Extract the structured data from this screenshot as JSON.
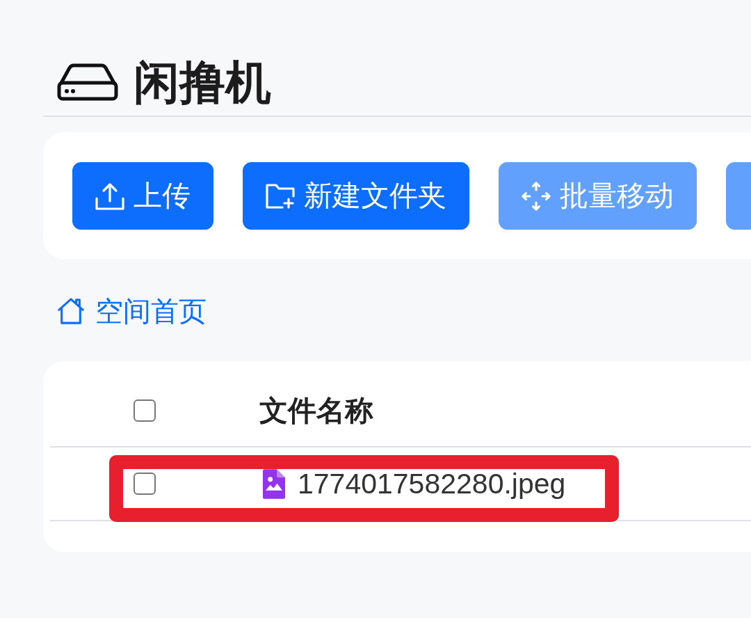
{
  "title": {
    "text": "闲撸机"
  },
  "toolbar": {
    "buttons": [
      {
        "kind": "upload",
        "label": "上传",
        "disabled": false
      },
      {
        "kind": "new_folder",
        "label": "新建文件夹",
        "disabled": false
      },
      {
        "kind": "batch_move",
        "label": "批量移动",
        "disabled": true
      },
      {
        "disabled": true
      }
    ]
  },
  "breadcrumb": [
    {
      "kind": "home",
      "label": "空间首页"
    }
  ],
  "table": {
    "select_all": {
      "checked": false
    },
    "columns": [
      {
        "label": "文件名称"
      }
    ],
    "rows": [
      {
        "kind": "image",
        "name": "1774017582280.jpeg",
        "checked": false,
        "highlighted": true
      }
    ]
  }
}
